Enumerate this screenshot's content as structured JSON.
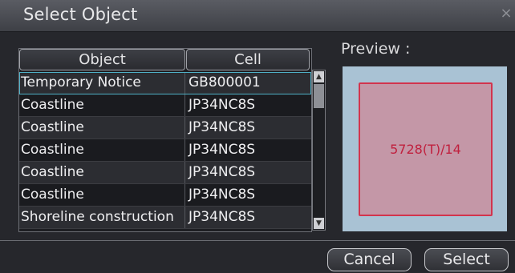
{
  "window": {
    "title": "Select Object",
    "close_icon": "×"
  },
  "table": {
    "columns": [
      "Object",
      "Cell"
    ],
    "rows": [
      {
        "object": "Temporary Notice",
        "cell": "GB800001",
        "selected": true
      },
      {
        "object": "Coastline",
        "cell": "JP34NC8S"
      },
      {
        "object": "Coastline",
        "cell": "JP34NC8S"
      },
      {
        "object": "Coastline",
        "cell": "JP34NC8S"
      },
      {
        "object": "Coastline",
        "cell": "JP34NC8S"
      },
      {
        "object": "Coastline",
        "cell": "JP34NC8S"
      },
      {
        "object": "Shoreline construction",
        "cell": "JP34NC8S"
      }
    ]
  },
  "preview": {
    "label": "Preview :",
    "text": "5728(T)/14"
  },
  "buttons": {
    "cancel": "Cancel",
    "select": "Select"
  },
  "colors": {
    "accent": "#4fb0c6",
    "preview_bg": "#a9c2d4",
    "preview_box": "#c497a7",
    "preview_border": "#d2344d"
  }
}
